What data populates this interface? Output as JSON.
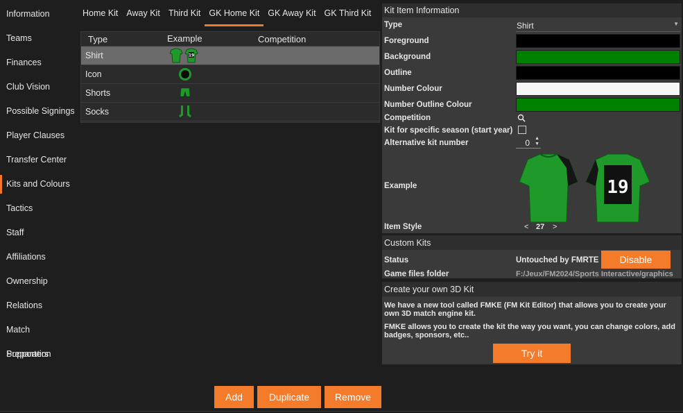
{
  "nav": {
    "items": [
      "Information",
      "Teams",
      "Finances",
      "Club Vision",
      "Possible Signings",
      "Player Clauses",
      "Transfer Center",
      "Kits and Colours",
      "Tactics",
      "Staff",
      "Affiliations",
      "Ownership",
      "Relations",
      "Match Preparation",
      "Supporters"
    ],
    "active": "Kits and Colours"
  },
  "tabs": [
    "Home Kit",
    "Away Kit",
    "Third Kit",
    "GK Home Kit",
    "GK Away Kit",
    "GK Third Kit"
  ],
  "active_tab": "GK Home Kit",
  "kit_table": {
    "headers": {
      "type": "Type",
      "example": "Example",
      "competition": "Competition"
    },
    "rows": [
      {
        "type": "Shirt",
        "example_icon": "shirt-pair-icon"
      },
      {
        "type": "Icon",
        "example_icon": "kit-circle-icon"
      },
      {
        "type": "Shorts",
        "example_icon": "shorts-icon"
      },
      {
        "type": "Socks",
        "example_icon": "socks-icon"
      }
    ]
  },
  "kit_item": {
    "title": "Kit Item Information",
    "type_label": "Type",
    "type_value": "Shirt",
    "foreground_label": "Foreground",
    "background_label": "Background",
    "outline_label": "Outline",
    "number_colour_label": "Number Colour",
    "number_outline_label": "Number Outline Colour",
    "competition_label": "Competition",
    "specific_season_label": "Kit for specific season (start year)",
    "alt_kit_label": "Alternative kit number",
    "alt_kit_value": "0",
    "example_label": "Example",
    "shirt_number": "19",
    "item_style_label": "Item Style",
    "item_style_value": "27",
    "prev_symbol": "<",
    "next_symbol": ">",
    "colors": {
      "foreground": "#000000",
      "background": "#008000",
      "outline": "#000000",
      "number_colour": "#f5f5f5",
      "number_outline": "#008000"
    }
  },
  "custom_kits": {
    "title": "Custom Kits",
    "status_label": "Status",
    "status_value": "Untouched by FMRTE",
    "disable_label": "Disable",
    "game_folder_label": "Game files folder",
    "game_folder_value": "F:/Jeux/FM2024/Sports Interactive/graphics"
  },
  "create_3d": {
    "title": "Create your own 3D Kit",
    "text1": "We have a new tool called FMKE (FM Kit Editor) that allows you to create your own 3D match engine kit.",
    "text2": "FMKE allows you to create the kit the way you want, you can change colors, add badges, sponsors, etc..",
    "try_label": "Try it"
  },
  "bottom_buttons": {
    "add": "Add",
    "duplicate": "Duplicate",
    "remove": "Remove"
  },
  "accent": "#f47b2a"
}
